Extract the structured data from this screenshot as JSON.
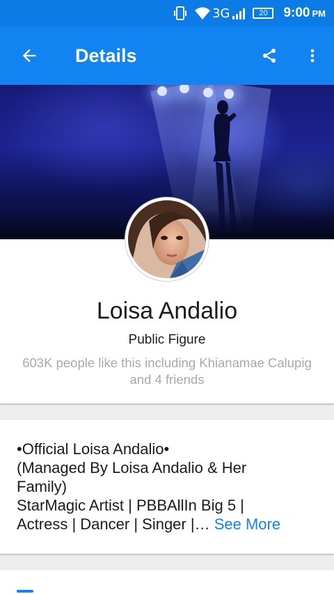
{
  "status_bar": {
    "network": "3G",
    "battery": "20",
    "time": "9:00",
    "ampm": "PM"
  },
  "app_bar": {
    "title": "Details",
    "icons": [
      "back-arrow-icon",
      "share-icon",
      "more-vert-icon"
    ]
  },
  "profile": {
    "name": "Loisa Andalio",
    "category": "Public Figure",
    "likes": "603K people like this including Khianamae Calupig and 4 friends"
  },
  "about": {
    "lines": [
      "•Official Loisa Andalio•",
      "(Managed By Loisa Andalio & Her",
      "Family)",
      "StarMagic Artist | PBBAllIn Big 5 |",
      "Actress | Dancer | Singer |…"
    ],
    "see_more": "See More"
  },
  "colors": {
    "status_bar": "#0c7be6",
    "app_bar": "#1284f2",
    "link": "#1284f2",
    "secondary_text": "#a9a9a9"
  }
}
